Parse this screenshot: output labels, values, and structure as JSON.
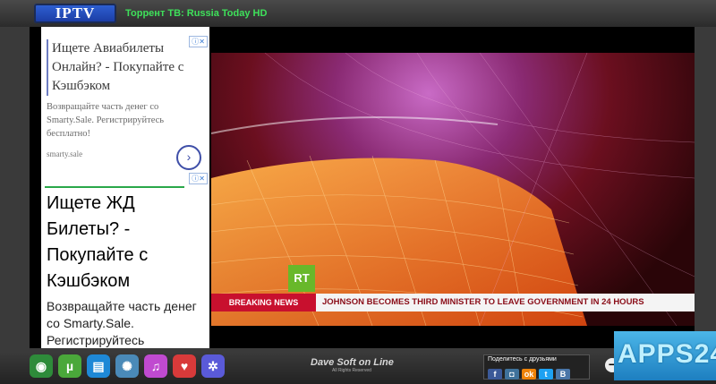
{
  "app": {
    "logo_text": "IPTV",
    "title": "Торрент ТВ: Russia Today HD"
  },
  "ads": {
    "badge": "ⓘ✕",
    "ad1": {
      "headline": "Ищете Авиабилеты Онлайн? - Покупайте с Кэшбэком",
      "body": "Возвращайте часть денег со Smarty.Sale. Регистрируйтесь бесплатно!",
      "source": "smarty.sale",
      "arrow": "›"
    },
    "ad2": {
      "headline": "Ищете ЖД Билеты? - Покупайте с Кэшбэком",
      "body": "Возвращайте часть денег со Smarty.Sale. Регистрируйтесь"
    }
  },
  "video": {
    "channel_logo": "RT",
    "ticker_tag": "BREAKING NEWS",
    "ticker_text": "JOHNSON BECOMES THIRD MINISTER TO LEAVE GOVERNMENT IN 24 HOURS"
  },
  "toolbar": {
    "icons": [
      {
        "name": "rss-icon",
        "glyph": "◉",
        "color": "#2e8b3a"
      },
      {
        "name": "torrent-icon",
        "glyph": "µ",
        "color": "#4aa83a"
      },
      {
        "name": "radio-icon",
        "glyph": "▤",
        "color": "#1e88d6"
      },
      {
        "name": "film-icon",
        "glyph": "✺",
        "color": "#4a8ab8"
      },
      {
        "name": "music-icon",
        "glyph": "♫",
        "color": "#c04ad0"
      },
      {
        "name": "favorite-add-icon",
        "glyph": "♥",
        "color": "#d83a3a"
      },
      {
        "name": "settings-icon",
        "glyph": "✲",
        "color": "#5a5ad8"
      }
    ],
    "brand": "Dave Soft on Line",
    "brand_small": "All Rights Reserved",
    "share_label": "Поделитесь с друзьями",
    "share_icons": [
      {
        "name": "facebook-icon",
        "glyph": "f",
        "color": "#3b5998"
      },
      {
        "name": "instagram-icon",
        "glyph": "◘",
        "color": "#3f729b"
      },
      {
        "name": "odnoklassniki-icon",
        "glyph": "ok",
        "color": "#ee8208"
      },
      {
        "name": "twitter-icon",
        "glyph": "t",
        "color": "#1da1f2"
      },
      {
        "name": "vk-icon",
        "glyph": "B",
        "color": "#4a76a8"
      }
    ],
    "minus": "−"
  },
  "watermark": "APPS24"
}
